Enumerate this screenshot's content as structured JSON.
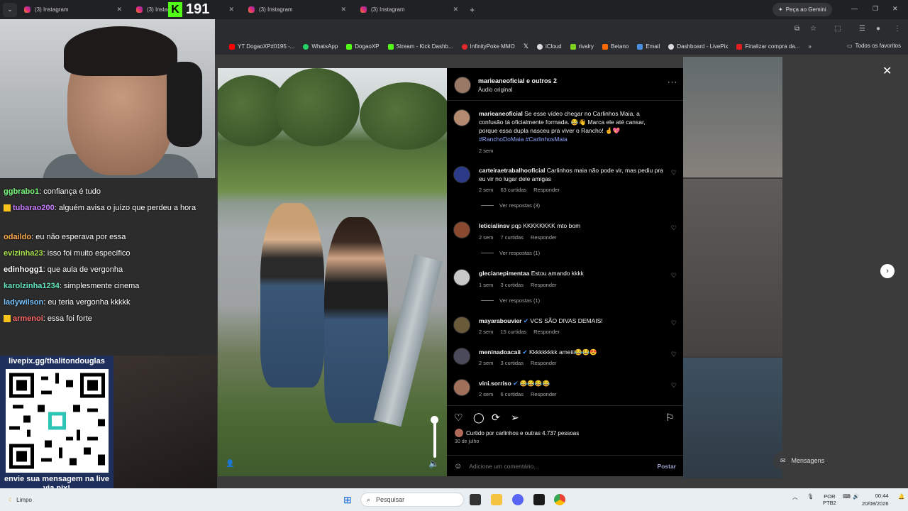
{
  "browser": {
    "tabs": [
      {
        "title": "(3) Instagram"
      },
      {
        "title": "(3) Instagr"
      },
      {
        "title": "(3) Instagram"
      },
      {
        "title": "(3) Instagram"
      }
    ],
    "new_tab": "+",
    "gemini_label": "Peça ao Gemini",
    "bookmarks": [
      {
        "label": "YT DogaoXP#0195 -...",
        "color": "#ff0000"
      },
      {
        "label": "WhatsApp",
        "color": "#25d366"
      },
      {
        "label": "DogaoXP",
        "color": "#53fc18"
      },
      {
        "label": "Stream - Kick Dashb...",
        "color": "#53fc18"
      },
      {
        "label": "InfinityPoke MMO",
        "color": "#e0292a"
      },
      {
        "label": "",
        "color": "#ffffff"
      },
      {
        "label": "iCloud",
        "color": "#dddddd"
      },
      {
        "label": "rivalry",
        "color": "#7ed321"
      },
      {
        "label": "Betano",
        "color": "#ff6a00"
      },
      {
        "label": "Email",
        "color": "#4a90e2"
      },
      {
        "label": "Dashboard - LivePix",
        "color": "#dddddd"
      },
      {
        "label": "Finalizar compra da...",
        "color": "#e02020"
      }
    ],
    "favorites_label": "Todos os favoritos"
  },
  "stream_overlay": {
    "viewer_count": "191",
    "chat": [
      {
        "nick": "ggbrabo1",
        "color": "#7CFC7C",
        "badge": false,
        "message": ": confiança é tudo"
      },
      {
        "nick": "tubarao200",
        "color": "#c77dff",
        "badge": true,
        "message": ": alguém avisa o juízo que perdeu a hora"
      },
      {
        "nick": "odaildo",
        "color": "#ffa94d",
        "badge": false,
        "message": ": eu não esperava por essa"
      },
      {
        "nick": "evizinha23",
        "color": "#a9e34b",
        "badge": false,
        "message": ": isso foi muito específico"
      },
      {
        "nick": "edinhogg1",
        "color": "#ffffff",
        "badge": false,
        "message": ": que aula de vergonha"
      },
      {
        "nick": "karolzinha1234",
        "color": "#63e6be",
        "badge": false,
        "message": ": simplesmente cinema"
      },
      {
        "nick": "ladywilson",
        "color": "#74c0fc",
        "badge": false,
        "message": ": eu teria vergonha kkkkk"
      },
      {
        "nick": "armenoi",
        "color": "#ff6b6b",
        "badge": true,
        "message": ": essa foi forte"
      }
    ],
    "qr_title": "livepix.gg/thalitondouglas",
    "qr_footer": "envie sua mensagem na live via pix!"
  },
  "post": {
    "header": {
      "title": "marieaneoficial e outros 2",
      "subtitle": "Áudio original"
    },
    "caption": {
      "user": "marieaneoficial",
      "text": "Se esse vídeo chegar no Carlinhos Maia, a confusão tá oficialmente formada. 😂👋 Marca ele até cansar, porque essa dupla nasceu pra viver o Rancho! 🤞💖",
      "tags": "#RanchoDoMaia #CarlinhosMaia",
      "time": "2 sem"
    },
    "comments": [
      {
        "user": "carteiraetrabalhooficial",
        "text": "Carlinhos maia não pode vir, mas pediu pra eu vir no lugar dele amigas",
        "time": "2 sem",
        "likes": "63 curtidas",
        "reply": "Responder",
        "view_replies": "Ver respostas (3)"
      },
      {
        "user": "leticialinsv",
        "text": "pqp KKKKKKKK mto bom",
        "time": "2 sem",
        "likes": "7 curtidas",
        "reply": "Responder",
        "view_replies": "Ver respostas (1)"
      },
      {
        "user": "glecianepimentaa",
        "text": "Estou amando kkkk",
        "time": "1 sem",
        "likes": "3 curtidas",
        "reply": "Responder",
        "view_replies": "Ver respostas (1)"
      },
      {
        "user": "mayarabouvier",
        "text": "VCS SÃO DIVAS DEMAIS!",
        "time": "2 sem",
        "likes": "15 curtidas",
        "reply": "Responder",
        "view_replies": ""
      },
      {
        "user": "meninadoacaii",
        "text": "Kkkkkkkkk ameiii😂😂😍",
        "time": "2 sem",
        "likes": "3 curtidas",
        "reply": "Responder",
        "view_replies": ""
      },
      {
        "user": "vini.sorriso",
        "text": "😂😂😂😂",
        "time": "2 sem",
        "likes": "6 curtidas",
        "reply": "Responder",
        "view_replies": ""
      }
    ],
    "liked_by": "Curtido por carlinhos e outras 4.737 pessoas",
    "date": "30 de julho",
    "comment_placeholder": "Adicione um comentário...",
    "post_button": "Postar"
  },
  "messages_label": "Mensagens",
  "taskbar": {
    "weather": "Limpo",
    "search_placeholder": "Pesquisar",
    "lang_top": "POR",
    "lang_bottom": "PTB2",
    "time": "00:44",
    "date": "20/08/2026"
  }
}
